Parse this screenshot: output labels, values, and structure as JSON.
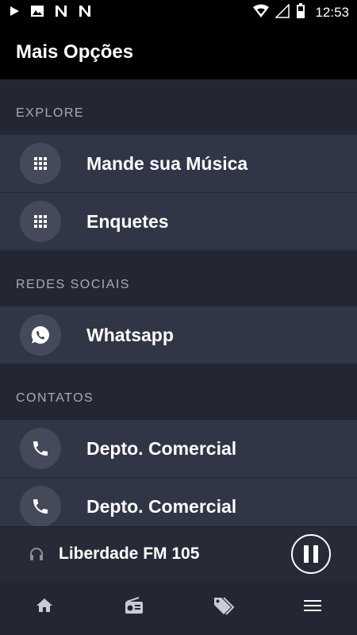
{
  "status_bar": {
    "time": "12:53",
    "left_icons": [
      "play-icon",
      "image-icon",
      "n-icon",
      "n-icon"
    ],
    "right_icons": [
      "wifi-icon",
      "signal-icon",
      "battery-icon"
    ]
  },
  "header": {
    "title": "Mais Opções"
  },
  "sections": [
    {
      "title": "EXPLORE",
      "items": [
        {
          "label": "Mande sua Música",
          "icon": "grid-icon"
        },
        {
          "label": "Enquetes",
          "icon": "grid-icon"
        }
      ]
    },
    {
      "title": "REDES SOCIAIS",
      "items": [
        {
          "label": "Whatsapp",
          "icon": "whatsapp-icon"
        }
      ]
    },
    {
      "title": "CONTATOS",
      "items": [
        {
          "label": "Depto. Comercial",
          "icon": "phone-icon"
        },
        {
          "label": "Depto. Comercial",
          "icon": "phone-icon"
        }
      ]
    }
  ],
  "player": {
    "station": "Liberdade FM 105",
    "icon": "headphones-icon",
    "control": "pause-icon"
  },
  "bottom_nav": {
    "items": [
      "home-icon",
      "radio-icon",
      "tag-icon",
      "menu-icon"
    ]
  },
  "colors": {
    "background": "#282d3a",
    "item_background": "#313646",
    "section_text": "#a8abb5",
    "icon_circle": "#454a5a"
  }
}
